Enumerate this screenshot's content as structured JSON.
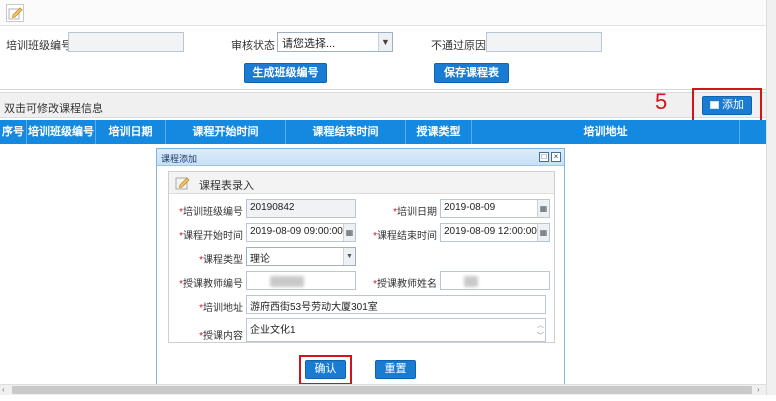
{
  "top_form": {
    "class_code_label": "培训班级编号",
    "class_code_value": "",
    "review_status_label": "审核状态",
    "review_status_value": "请您选择...",
    "reject_reason_label": "不通过原因",
    "reject_reason_value": "",
    "generate_button": "生成班级编号",
    "save_schedule_button": "保存课程表"
  },
  "info_bar": {
    "hint": "双击可修改课程信息",
    "add_button": "添加",
    "annotation": "5"
  },
  "grid": {
    "columns": [
      "序号",
      "培训班级编号",
      "培训日期",
      "课程开始时间",
      "课程结束时间",
      "授课类型",
      "培训地址"
    ]
  },
  "dialog": {
    "title": "课程添加",
    "panel_title": "课程表录入",
    "fields": {
      "class_code": {
        "label": "培训班级编号",
        "value": "20190842"
      },
      "train_date": {
        "label": "培训日期",
        "value": "2019-08-09"
      },
      "start_time": {
        "label": "课程开始时间",
        "value": "2019-08-09 09:00:00"
      },
      "end_time": {
        "label": "课程结束时间",
        "value": "2019-08-09 12:00:00"
      },
      "course_type": {
        "label": "课程类型",
        "value": "理论"
      },
      "teacher_id": {
        "label": "授课教师编号",
        "value": ""
      },
      "teacher_name": {
        "label": "授课教师姓名",
        "value": ""
      },
      "address": {
        "label": "培训地址",
        "value": "游府西街53号劳动大厦301室"
      },
      "content": {
        "label": "授课内容",
        "value": "企业文化1"
      }
    },
    "confirm_button": "确认",
    "reset_button": "重置"
  },
  "colors": {
    "accent": "#1589e0",
    "annotation_red": "#d4121c"
  }
}
